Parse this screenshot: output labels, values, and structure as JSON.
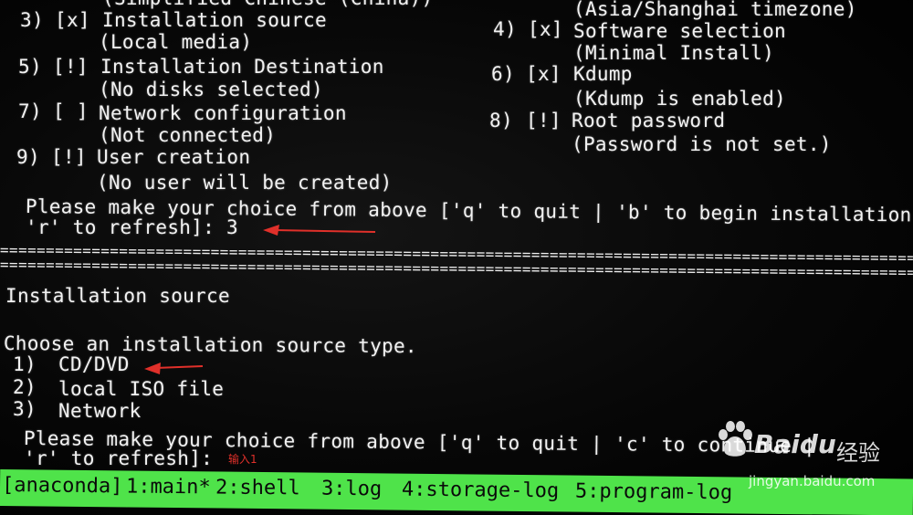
{
  "summary": {
    "top_partial_left": "(Simplified Chinese (China))",
    "top_partial_right": "(Asia/Shanghai timezone)",
    "items": [
      {
        "num": "3)",
        "mark": "[x]",
        "title": "Installation source",
        "status": "(Local media)"
      },
      {
        "num": "4)",
        "mark": "[x]",
        "title": "Software selection",
        "status": "(Minimal Install)"
      },
      {
        "num": "5)",
        "mark": "[!]",
        "title": "Installation Destination",
        "status": "(No disks selected)"
      },
      {
        "num": "6)",
        "mark": "[x]",
        "title": "Kdump",
        "status": "(Kdump is enabled)"
      },
      {
        "num": "7)",
        "mark": "[ ]",
        "title": "Network configuration",
        "status": "(Not connected)"
      },
      {
        "num": "8)",
        "mark": "[!]",
        "title": "Root password",
        "status": "(Password is not set.)"
      },
      {
        "num": "9)",
        "mark": "[!]",
        "title": "User creation",
        "status": "(No user will be created)"
      }
    ],
    "prompt_line1": "Please make your choice from above ['q' to quit | 'b' to begin installation |",
    "prompt_line2": "'r' to refresh]: 3"
  },
  "separator": "=====================================================================================================",
  "source_screen": {
    "title": "Installation source",
    "question": "Choose an installation source type.",
    "options": [
      {
        "num": "1)",
        "label": "CD/DVD"
      },
      {
        "num": "2)",
        "label": "local ISO file"
      },
      {
        "num": "3)",
        "label": "Network"
      }
    ],
    "prompt_line1": "Please make your choice from above ['q' to quit | 'c' to continue |",
    "prompt_line2": "'r' to refresh]:"
  },
  "annotation": {
    "text": "输入1",
    "color": "#e0302a"
  },
  "tmux": {
    "session": "[anaconda]",
    "windows": [
      "1:main*",
      "2:shell",
      "3:log",
      "4:storage-log",
      "5:program-log"
    ],
    "bar_color": "#4fe34a"
  },
  "watermark": {
    "brand": "Baidu",
    "cn": "经验",
    "url": "jingyan.baidu.com"
  }
}
